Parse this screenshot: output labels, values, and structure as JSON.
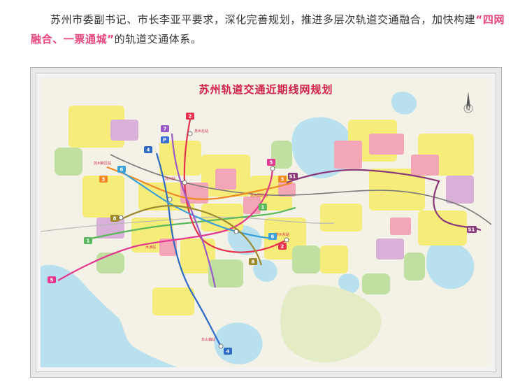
{
  "article": {
    "sentence_before": "苏州市委副书记、市长李亚平要求，深化完善规划，推进多层次轨道交通融合，加快构建",
    "highlight": "“四网融合、一票通城”",
    "sentence_after": "的轨道交通体系。"
  },
  "map": {
    "title": "苏州轨道交通近期线网规划",
    "compass_letter": "N",
    "station_labels": [
      "苏州北站",
      "苏州新区站",
      "苏州站",
      "苏州园区站",
      "苏州东站",
      "木渎站",
      "东山镇站"
    ],
    "line_badges": [
      {
        "id": "2",
        "color": "#e5334f"
      },
      {
        "id": "7",
        "color": "#9b59c8"
      },
      {
        "id": "P",
        "color": "#3b6fd4"
      },
      {
        "id": "4",
        "color": "#2e6ac4"
      },
      {
        "id": "6",
        "color": "#3aa0d8"
      },
      {
        "id": "3",
        "color": "#f08a24"
      },
      {
        "id": "5",
        "color": "#e2398e"
      },
      {
        "id": "S1",
        "color": "#8a3a7a"
      },
      {
        "id": "1",
        "color": "#5cb85c"
      },
      {
        "id": "8",
        "color": "#9c8a2c"
      }
    ],
    "line_colors": {
      "line1": "#5cb85c",
      "line2": "#e5334f",
      "line3": "#f08a24",
      "line4": "#2e6ac4",
      "line5": "#e2398e",
      "line6": "#3aa0d8",
      "line7": "#9b59c8",
      "line8": "#9c8a2c",
      "s1": "#8a3a7a",
      "rail": "#7a7a7a"
    },
    "land_colors": {
      "water": "#b9e0ef",
      "residential": "#f6ec7a",
      "commercial": "#f3a6b6",
      "industrial": "#d8b0d8",
      "green": "#bfe0a0",
      "dark_green": "#8fca7a"
    }
  }
}
